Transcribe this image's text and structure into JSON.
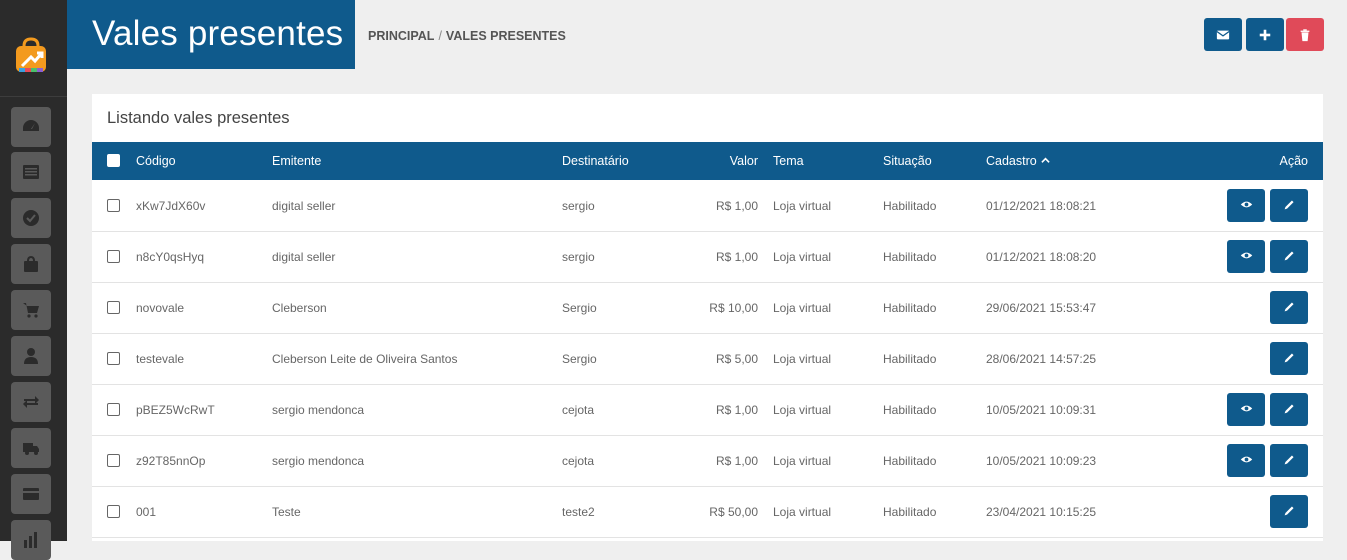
{
  "header": {
    "title": "Vales presentes",
    "breadcrumb_home": "PRINCIPAL",
    "breadcrumb_sep": "/",
    "breadcrumb_current": "VALES PRESENTES"
  },
  "sidebar": {
    "items": [
      {
        "icon": "dashboard-icon"
      },
      {
        "icon": "list-icon"
      },
      {
        "icon": "check-circle-icon"
      },
      {
        "icon": "shopping-bag-icon"
      },
      {
        "icon": "cart-icon"
      },
      {
        "icon": "user-icon"
      },
      {
        "icon": "exchange-icon"
      },
      {
        "icon": "truck-icon"
      },
      {
        "icon": "credit-card-icon"
      },
      {
        "icon": "bar-chart-icon"
      }
    ]
  },
  "panel": {
    "title": "Listando vales presentes",
    "columns": {
      "codigo": "Código",
      "emitente": "Emitente",
      "destinatario": "Destinatário",
      "valor": "Valor",
      "tema": "Tema",
      "situacao": "Situação",
      "cadastro": "Cadastro",
      "acao": "Ação"
    },
    "rows": [
      {
        "codigo": "xKw7JdX60v",
        "emitente": "digital seller",
        "destinatario": "sergio",
        "valor": "R$ 1,00",
        "tema": "Loja virtual",
        "situacao": "Habilitado",
        "cadastro": "01/12/2021 18:08:21",
        "view": true
      },
      {
        "codigo": "n8cY0qsHyq",
        "emitente": "digital seller",
        "destinatario": "sergio",
        "valor": "R$ 1,00",
        "tema": "Loja virtual",
        "situacao": "Habilitado",
        "cadastro": "01/12/2021 18:08:20",
        "view": true
      },
      {
        "codigo": "novovale",
        "emitente": "Cleberson",
        "destinatario": "Sergio",
        "valor": "R$ 10,00",
        "tema": "Loja virtual",
        "situacao": "Habilitado",
        "cadastro": "29/06/2021 15:53:47",
        "view": false
      },
      {
        "codigo": "testevale",
        "emitente": "Cleberson Leite de Oliveira Santos",
        "destinatario": "Sergio",
        "valor": "R$ 5,00",
        "tema": "Loja virtual",
        "situacao": "Habilitado",
        "cadastro": "28/06/2021 14:57:25",
        "view": false
      },
      {
        "codigo": "pBEZ5WcRwT",
        "emitente": "sergio mendonca",
        "destinatario": "cejota",
        "valor": "R$ 1,00",
        "tema": "Loja virtual",
        "situacao": "Habilitado",
        "cadastro": "10/05/2021 10:09:31",
        "view": true
      },
      {
        "codigo": "z92T85nnOp",
        "emitente": "sergio mendonca",
        "destinatario": "cejota",
        "valor": "R$ 1,00",
        "tema": "Loja virtual",
        "situacao": "Habilitado",
        "cadastro": "10/05/2021 10:09:23",
        "view": true
      },
      {
        "codigo": "001",
        "emitente": "Teste",
        "destinatario": "teste2",
        "valor": "R$ 50,00",
        "tema": "Loja virtual",
        "situacao": "Habilitado",
        "cadastro": "23/04/2021 10:15:25",
        "view": false
      }
    ]
  },
  "colors": {
    "primary": "#0f5a8c",
    "danger": "#e04a59",
    "sidebar": "#2b2b2b"
  }
}
